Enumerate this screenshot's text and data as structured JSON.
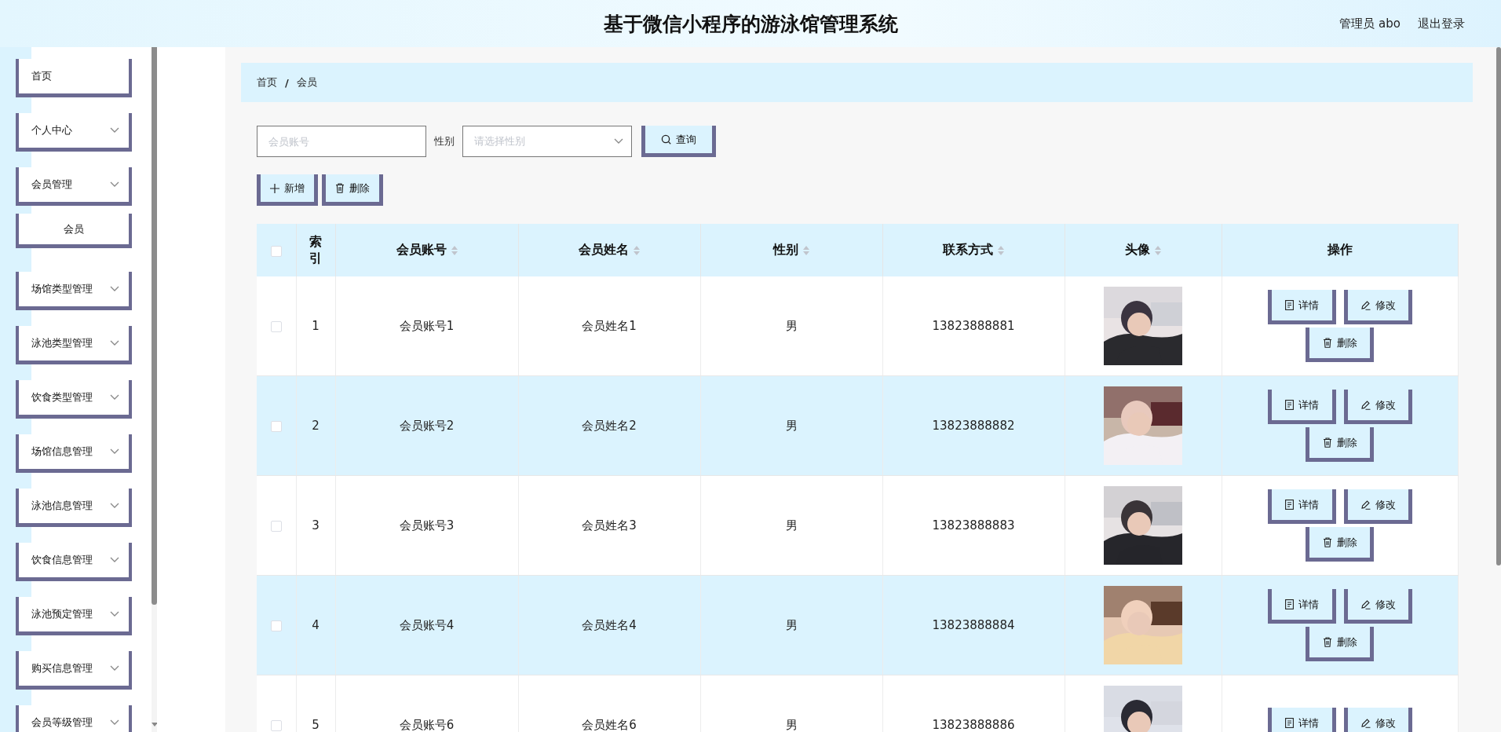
{
  "header": {
    "title": "基于微信小程序的游泳馆管理系统",
    "user": "管理员 abo",
    "logout": "退出登录"
  },
  "sidebar": {
    "items": [
      {
        "label": "首页",
        "kind": "link"
      },
      {
        "label": "个人中心",
        "kind": "submenu"
      },
      {
        "label": "会员管理",
        "kind": "submenu",
        "children": [
          {
            "label": "会员"
          }
        ]
      },
      {
        "label": "场馆类型管理",
        "kind": "submenu"
      },
      {
        "label": "泳池类型管理",
        "kind": "submenu"
      },
      {
        "label": "饮食类型管理",
        "kind": "submenu"
      },
      {
        "label": "场馆信息管理",
        "kind": "submenu"
      },
      {
        "label": "泳池信息管理",
        "kind": "submenu"
      },
      {
        "label": "饮食信息管理",
        "kind": "submenu"
      },
      {
        "label": "泳池预定管理",
        "kind": "submenu"
      },
      {
        "label": "购买信息管理",
        "kind": "submenu"
      },
      {
        "label": "会员等级管理",
        "kind": "submenu"
      }
    ]
  },
  "breadcrumb": {
    "items": [
      "首页",
      "会员"
    ],
    "separator": "/"
  },
  "search": {
    "account_field": {
      "placeholder": "会员账号"
    },
    "gender_label": "性别",
    "gender_select": {
      "placeholder": "请选择性别"
    },
    "query_button": "查询"
  },
  "toolbar": [
    {
      "label": "新增",
      "kind": "add"
    },
    {
      "label": "删除",
      "kind": "delete"
    }
  ],
  "table": {
    "select_all": {
      "checked": false
    },
    "columns": [
      {
        "label": "索引",
        "sortable": false
      },
      {
        "label": "会员账号",
        "sortable": true
      },
      {
        "label": "会员姓名",
        "sortable": true
      },
      {
        "label": "性别",
        "sortable": true
      },
      {
        "label": "联系方式",
        "sortable": true
      },
      {
        "label": "头像",
        "sortable": true
      },
      {
        "label": "操作",
        "sortable": false
      }
    ],
    "rows": [
      {
        "checked": false,
        "index": "1",
        "account": "会员账号1",
        "name": "会员姓名1",
        "gender": "男",
        "phone": "13823888881",
        "avatar": {
          "kind": "picture"
        },
        "actions": [
          {
            "label": "详情",
            "kind": "detail"
          },
          {
            "label": "修改",
            "kind": "edit"
          },
          {
            "label": "删除",
            "kind": "delete"
          }
        ]
      },
      {
        "checked": false,
        "index": "2",
        "account": "会员账号2",
        "name": "会员姓名2",
        "gender": "男",
        "phone": "13823888882",
        "avatar": {
          "kind": "picture"
        },
        "actions": [
          {
            "label": "详情",
            "kind": "detail"
          },
          {
            "label": "修改",
            "kind": "edit"
          },
          {
            "label": "删除",
            "kind": "delete"
          }
        ]
      },
      {
        "checked": false,
        "index": "3",
        "account": "会员账号3",
        "name": "会员姓名3",
        "gender": "男",
        "phone": "13823888883",
        "avatar": {
          "kind": "picture"
        },
        "actions": [
          {
            "label": "详情",
            "kind": "detail"
          },
          {
            "label": "修改",
            "kind": "edit"
          },
          {
            "label": "删除",
            "kind": "delete"
          }
        ]
      },
      {
        "checked": false,
        "index": "4",
        "account": "会员账号4",
        "name": "会员姓名4",
        "gender": "男",
        "phone": "13823888884",
        "avatar": {
          "kind": "picture"
        },
        "actions": [
          {
            "label": "详情",
            "kind": "detail"
          },
          {
            "label": "修改",
            "kind": "edit"
          },
          {
            "label": "删除",
            "kind": "delete"
          }
        ]
      },
      {
        "checked": false,
        "index": "5",
        "account": "会员账号6",
        "name": "会员姓名6",
        "gender": "男",
        "phone": "13823888886",
        "avatar": {
          "kind": "picture"
        },
        "actions": [
          {
            "label": "详情",
            "kind": "detail"
          },
          {
            "label": "修改",
            "kind": "edit"
          }
        ]
      }
    ]
  }
}
